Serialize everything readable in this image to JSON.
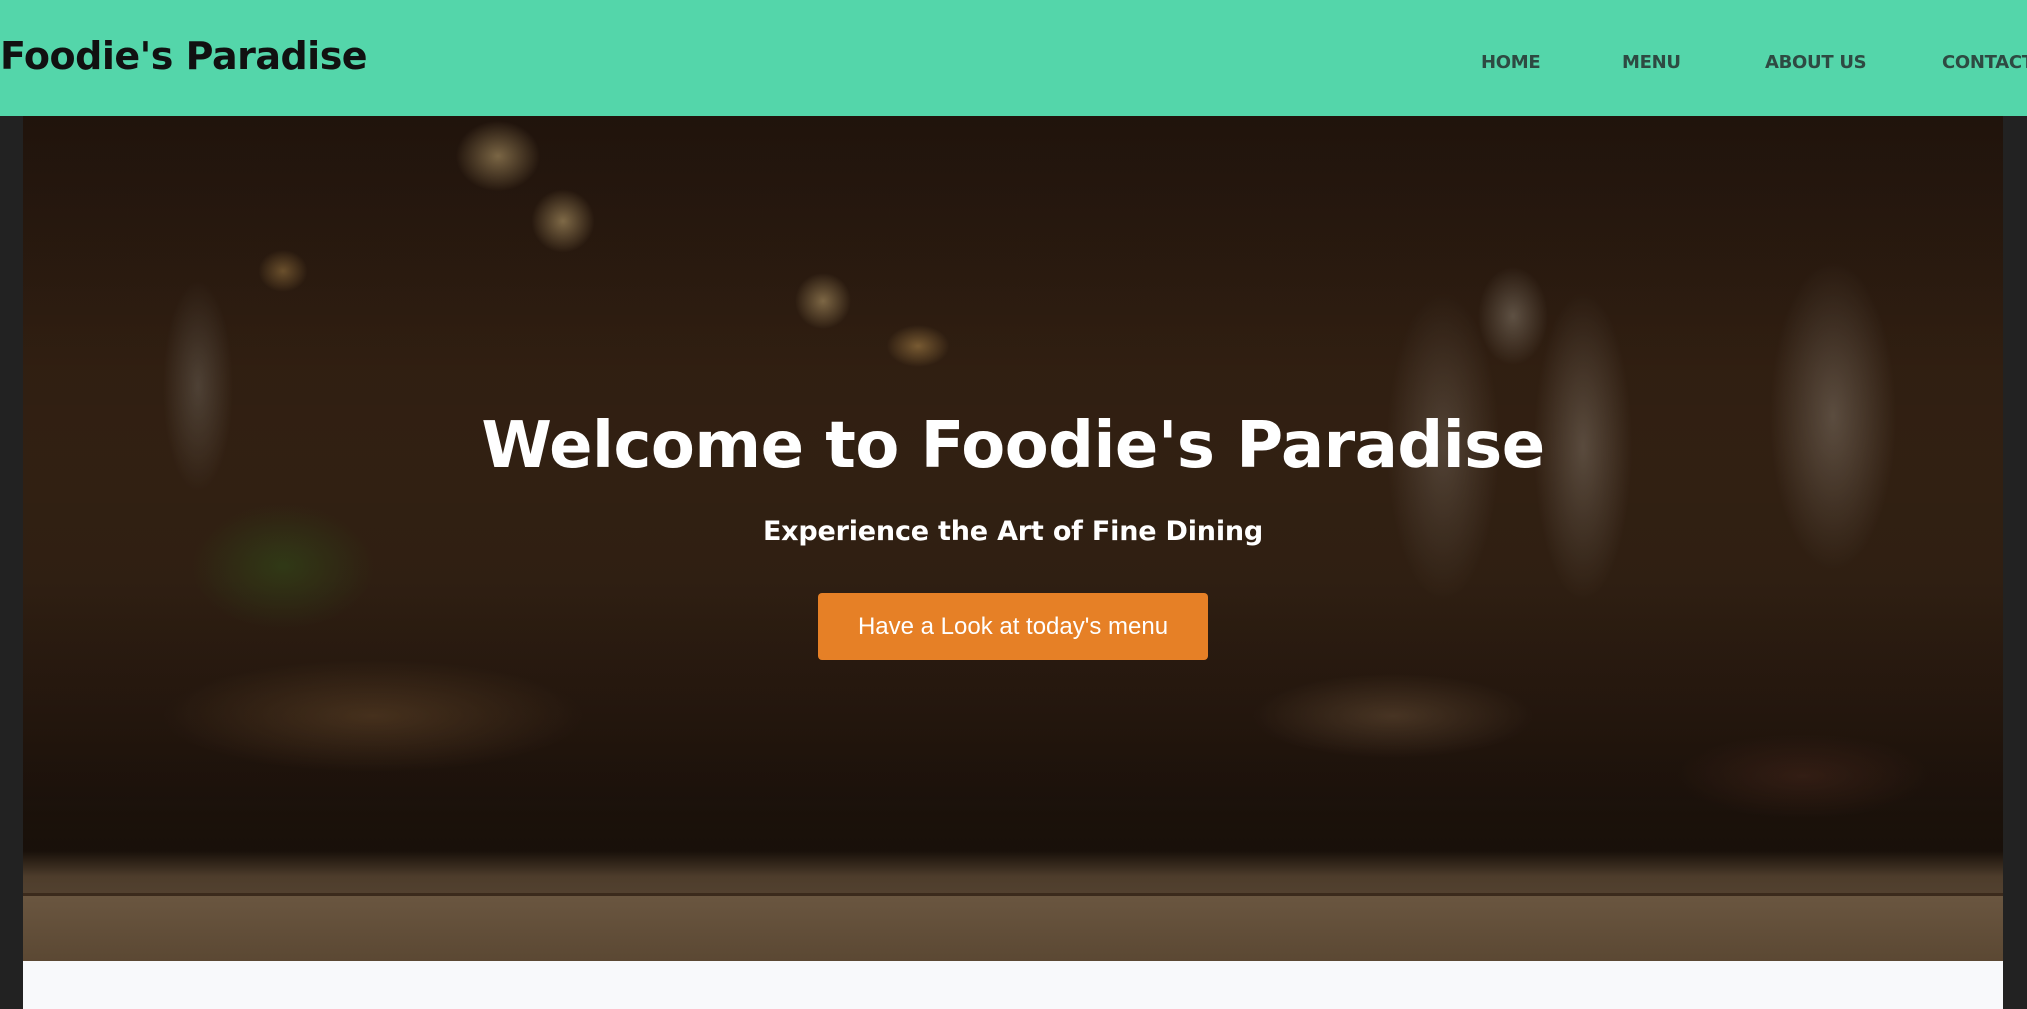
{
  "navbar": {
    "brand": "Foodie's Paradise",
    "links": [
      "HOME",
      "MENU",
      "ABOUT US",
      "CONTACT"
    ],
    "background": "#54d6aa"
  },
  "hero": {
    "title": "Welcome to Foodie's Paradise",
    "subtitle": "Experience the Art of Fine Dining",
    "button_label": "Have a Look at today's menu",
    "button_color": "#e68026",
    "background_image": "blurred restaurant interior"
  }
}
